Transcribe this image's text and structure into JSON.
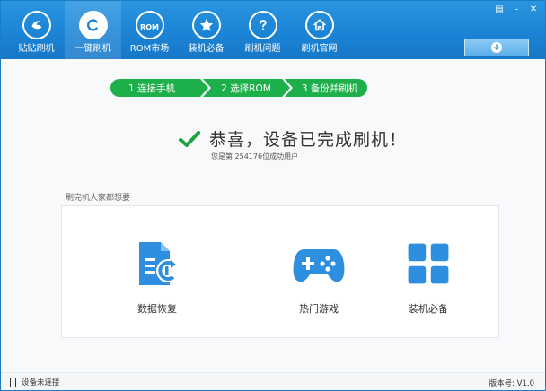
{
  "nav": {
    "items": [
      {
        "label": "贴贴刷机",
        "icon": "swirl-logo-icon"
      },
      {
        "label": "一键刷机",
        "icon": "c-logo-icon"
      },
      {
        "label": "ROM市场",
        "icon": "rom-bag-icon",
        "icon_text": "ROM"
      },
      {
        "label": "装机必备",
        "icon": "star-icon"
      },
      {
        "label": "刷机问题",
        "icon": "question-icon"
      },
      {
        "label": "刷机官网",
        "icon": "home-icon"
      }
    ],
    "active_index": 1
  },
  "window_controls": {
    "skin": "▤",
    "minimize": "–",
    "close": "✕"
  },
  "steps": [
    {
      "label": "1  连接手机"
    },
    {
      "label": "2  选择ROM"
    },
    {
      "label": "3  备份并刷机"
    }
  ],
  "success": {
    "title": "恭喜，设备已完成刷机！",
    "subtitle": "您是第 254176位成功用户"
  },
  "recommend": {
    "heading": "刷完机大家都想要",
    "items": [
      {
        "label": "数据恢复",
        "icon": "data-recovery-icon"
      },
      {
        "label": "热门游戏",
        "icon": "gamepad-icon"
      },
      {
        "label": "装机必备",
        "icon": "apps-grid-icon"
      }
    ]
  },
  "status": {
    "connection": "设备未连接",
    "version": "版本号: V1.0"
  },
  "colors": {
    "topbar": "#1b84d6",
    "step_green": "#1db04a",
    "check_green": "#1aa43f",
    "icon_blue": "#2e8fe0"
  }
}
